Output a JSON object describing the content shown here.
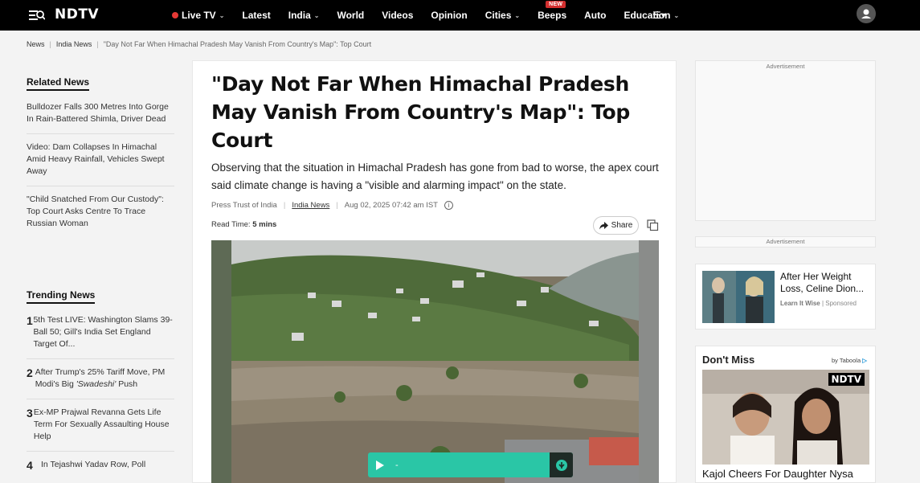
{
  "header": {
    "logo": "NDTV",
    "nav": [
      {
        "label": "Live TV",
        "live": true,
        "chevron": true
      },
      {
        "label": "Latest"
      },
      {
        "label": "India",
        "chevron": true
      },
      {
        "label": "World"
      },
      {
        "label": "Videos"
      },
      {
        "label": "Opinion"
      },
      {
        "label": "Cities",
        "chevron": true
      },
      {
        "label": "Beeps",
        "badge": "NEW"
      },
      {
        "label": "Auto"
      },
      {
        "label": "Education",
        "chevron": true
      }
    ],
    "icons": {
      "menu": "menu-search-icon",
      "more": "hamburger-more-icon",
      "user": "user-avatar-icon"
    }
  },
  "breadcrumb": {
    "items": [
      "News",
      "India News"
    ],
    "current": "\"Day Not Far When Himachal Pradesh May Vanish From Country's Map\": Top Court"
  },
  "related": {
    "title": "Related News",
    "items": [
      "Bulldozer Falls 300 Metres Into Gorge In Rain-Battered Shimla, Driver Dead",
      "Video: Dam Collapses In Himachal Amid Heavy Rainfall, Vehicles Swept Away",
      "\"Child Snatched From Our Custody\": Top Court Asks Centre To Trace Russian Woman"
    ]
  },
  "trending": {
    "title": "Trending News",
    "items": [
      {
        "num": "1",
        "text": "5th Test LIVE: Washington Slams 39-Ball 50; Gill's India Set England Target Of..."
      },
      {
        "num": "2",
        "text": "After Trump's 25% Tariff Move, PM Modi's Big",
        "italic": "'Swadeshi'",
        "after": "Push"
      },
      {
        "num": "3",
        "text": "Ex-MP Prajwal Revanna Gets Life Term For Sexually Assaulting House Help"
      },
      {
        "num": "4",
        "text": "In Tejashwi Yadav Row, Poll"
      }
    ]
  },
  "article": {
    "headline": "\"Day Not Far When Himachal Pradesh May Vanish From Country's Map\": Top Court",
    "summary": "Observing that the situation in Himachal Pradesh has gone from bad to worse, the apex court said climate change is having a \"visible and alarming impact\" on the state.",
    "source": "Press Trust of India",
    "category": "India News",
    "date": "Aug 02, 2025 07:42 am IST",
    "read_time_label": "Read Time:",
    "read_time": "5 mins",
    "share_label": "Share",
    "audio_text": "-"
  },
  "ads": {
    "label1": "Advertisement",
    "label2": "Advertisement"
  },
  "sponsored": {
    "title": "After Her Weight Loss, Celine Dion...",
    "source": "Learn It Wise",
    "tag": "Sponsored"
  },
  "dont_miss": {
    "title": "Don't Miss",
    "by": "by Taboola",
    "image_logo": "NDTV",
    "caption": "Kajol Cheers For Daughter Nysa"
  }
}
